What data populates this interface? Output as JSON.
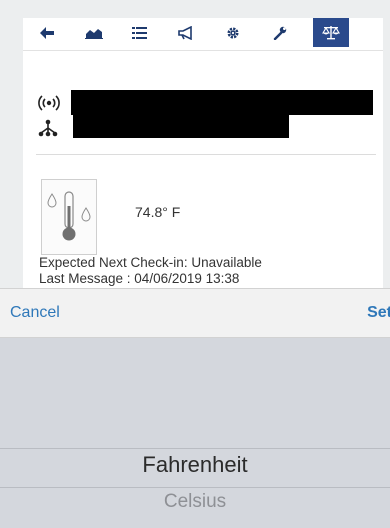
{
  "toolbar": {
    "items": [
      {
        "icon": "back-arrow-icon",
        "active": false
      },
      {
        "icon": "area-chart-icon",
        "active": false
      },
      {
        "icon": "list-icon",
        "active": false
      },
      {
        "icon": "megaphone-icon",
        "active": false
      },
      {
        "icon": "gear-icon",
        "active": false
      },
      {
        "icon": "wrench-icon",
        "active": false
      },
      {
        "icon": "balance-scale-icon",
        "active": true
      }
    ],
    "active_color": "#2a4a8c",
    "icon_color": "#1e3a6e"
  },
  "device": {
    "signal_icon": "signal-broadcast-icon",
    "network_icon": "network-nodes-icon",
    "name_redacted": true,
    "network_redacted": true
  },
  "sensor": {
    "icon": "thermometer-droplets-icon",
    "reading": "74.8° F"
  },
  "status": {
    "expected_checkin": "Expected Next Check-in: Unavailable",
    "last_message": "Last Message : 04/06/2019 13:38"
  },
  "picker": {
    "cancel_label": "Cancel",
    "set_label": "Set",
    "options": [
      "Fahrenheit",
      "Celsius"
    ],
    "selected": "Fahrenheit",
    "accent_color": "#2f78b9"
  }
}
